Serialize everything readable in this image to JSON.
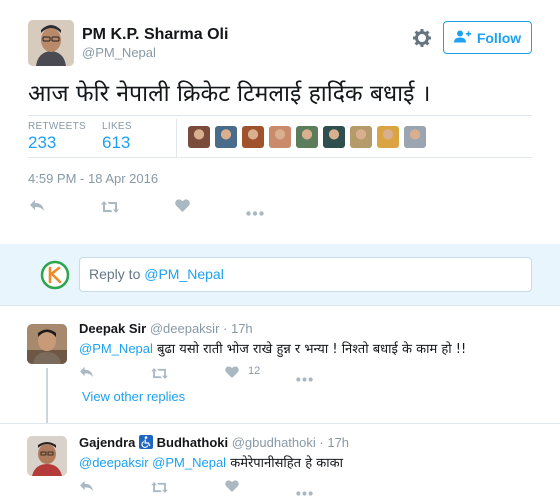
{
  "tweet": {
    "name": "PM K.P. Sharma Oli",
    "handle": "@PM_Nepal",
    "follow_label": "Follow",
    "text": "आज फेरि नेपाली क्रिकेट टिमलाई हार्दिक बधाई ।",
    "retweets_label": "RETWEETS",
    "retweets_count": "233",
    "likes_label": "LIKES",
    "likes_count": "613",
    "timestamp": "4:59 PM - 18 Apr 2016",
    "icons": [
      "settings-gear-icon",
      "follow-person-plus-icon",
      "reply-icon",
      "retweet-icon",
      "like-heart-icon",
      "more-icon"
    ]
  },
  "reply_box": {
    "placeholder_prefix": "Reply to",
    "placeholder_mention": "@PM_Nepal"
  },
  "replies": [
    {
      "name": "Deepak Sir",
      "handle": "@deepaksir",
      "time": "· 17h",
      "mention": "@PM_Nepal",
      "text": "बुढा यसो राती भोज राखे हुन्न र भन्या ! निश्तो बधाई के काम हो !!",
      "likes": "12"
    },
    {
      "name": "Gajendra",
      "name_icon": "wheelchair-icon",
      "name2": "Budhathoki",
      "handle": "@gbudhathoki",
      "time": "· 17h",
      "mention": "@deepaksir @PM_Nepal",
      "text": "कमेरेपानीसहित हे काका"
    }
  ],
  "view_other_replies": "View other replies",
  "colors": {
    "accent": "#1da1f2",
    "muted": "#8899a6",
    "reply_bg": "#e8f5fd",
    "icon_gray": "#aab8c2"
  }
}
